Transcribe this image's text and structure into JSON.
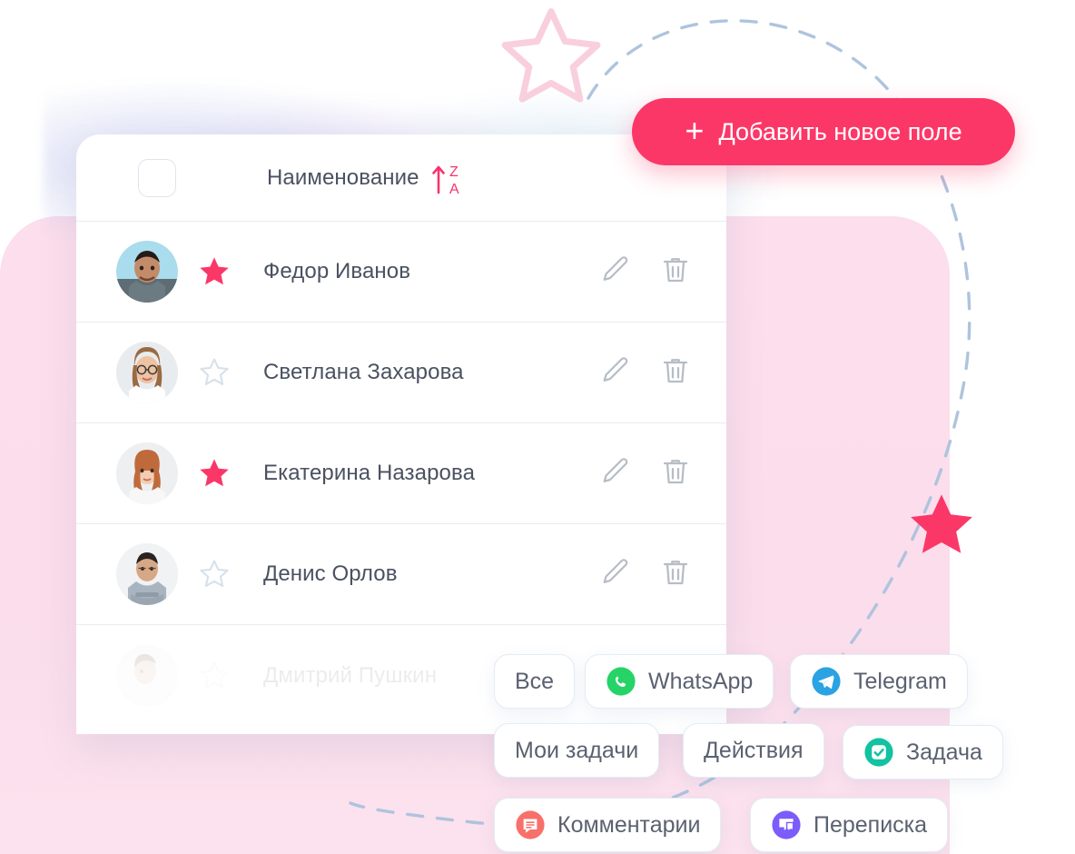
{
  "cta": {
    "label": "Добавить новое поле",
    "plus": "+",
    "icon": "plus-icon",
    "color": "#FB3768"
  },
  "table": {
    "header": {
      "checkbox_name": "select-all-checkbox",
      "column_title": "Наименование",
      "sort_icon": "sort-za-ascending-icon",
      "sort_letters_top": "Z",
      "sort_letters_bottom": "A",
      "sort_color": "#F5356E"
    },
    "action_icons": {
      "edit": "pencil-edit-icon",
      "delete": "trash-delete-icon"
    },
    "rows": [
      {
        "name": "Федор Иванов",
        "starred": true,
        "avatar": "avatar-fedor",
        "faded": false
      },
      {
        "name": "Светлана Захарова",
        "starred": false,
        "avatar": "avatar-svetlana",
        "faded": false
      },
      {
        "name": "Екатерина Назарова",
        "starred": true,
        "avatar": "avatar-ekaterina",
        "faded": false
      },
      {
        "name": "Денис Орлов",
        "starred": false,
        "avatar": "avatar-denis",
        "faded": false
      },
      {
        "name": "Дмитрий Пушкин",
        "starred": false,
        "avatar": "avatar-dmitriy",
        "faded": true
      }
    ]
  },
  "chips": [
    {
      "id": "all",
      "label": "Все",
      "icon": null,
      "icon_color": null
    },
    {
      "id": "whatsapp",
      "label": "WhatsApp",
      "icon": "whatsapp-icon",
      "icon_color": "#25D366"
    },
    {
      "id": "telegram",
      "label": "Telegram",
      "icon": "telegram-icon",
      "icon_color": "#2BA3E3"
    },
    {
      "id": "mytasks",
      "label": "Мои задачи",
      "icon": null,
      "icon_color": null
    },
    {
      "id": "actions",
      "label": "Действия",
      "icon": null,
      "icon_color": null
    },
    {
      "id": "task",
      "label": "Задача",
      "icon": "task-check-icon",
      "icon_color": "#12C2A0"
    },
    {
      "id": "comments",
      "label": "Комментарии",
      "icon": "comment-icon",
      "icon_color": "#F8706A"
    },
    {
      "id": "chat",
      "label": "Переписка",
      "icon": "chat-icon",
      "icon_color": "#7C5CFA"
    }
  ],
  "decor": {
    "star_white": "star-outline-white",
    "star_pink": "star-filled-pink",
    "star_pink_color": "#FB3768",
    "panel_color": "#FBDCEA",
    "dashed_curve": "dashed-curve-decoration",
    "dash_color": "#AEC4DE"
  }
}
